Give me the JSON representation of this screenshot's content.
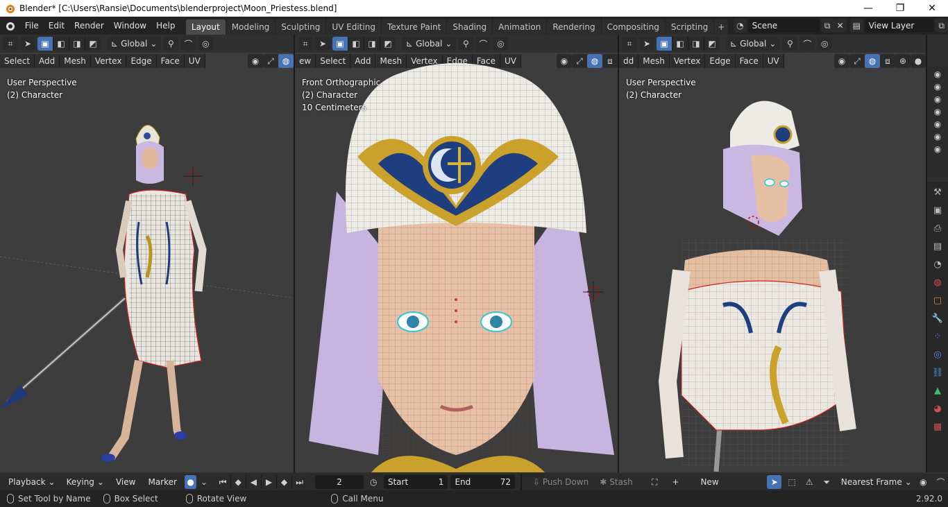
{
  "window": {
    "title": "Blender* [C:\\Users\\Ransie\\Documents\\blenderproject\\Moon_Priestess.blend]",
    "minimize": "—",
    "maximize": "❐",
    "close": "✕"
  },
  "topbar": {
    "menus": [
      "File",
      "Edit",
      "Render",
      "Window",
      "Help"
    ],
    "workspaces": [
      "Layout",
      "Modeling",
      "Sculpting",
      "UV Editing",
      "Texture Paint",
      "Shading",
      "Animation",
      "Rendering",
      "Compositing",
      "Scripting"
    ],
    "active_workspace": "Layout",
    "add_tab": "+",
    "scene": "Scene",
    "view_layer": "View Layer"
  },
  "viewports": [
    {
      "transform_orientation": "Global",
      "menus": [
        "Select",
        "Add",
        "Mesh",
        "Vertex",
        "Edge",
        "Face",
        "UV"
      ],
      "overlay_lines": [
        "User Perspective",
        "(2) Character"
      ]
    },
    {
      "transform_orientation": "Global",
      "menus": [
        "ew",
        "Select",
        "Add",
        "Mesh",
        "Vertex",
        "Edge",
        "Face",
        "UV"
      ],
      "overlay_lines": [
        "Front Orthographic",
        "(2) Character",
        "10 Centimeters"
      ]
    },
    {
      "transform_orientation": "Global",
      "menus": [
        "dd",
        "Mesh",
        "Vertex",
        "Edge",
        "Face",
        "UV"
      ],
      "overlay_lines": [
        "User Perspective",
        "(2) Character"
      ]
    }
  ],
  "timeline": {
    "playback": "Playback",
    "keying": "Keying",
    "view": "View",
    "marker": "Marker",
    "current_frame": "2",
    "start_label": "Start",
    "start": "1",
    "end_label": "End",
    "end": "72",
    "push_down": "Push Down",
    "stash": "Stash",
    "new_label": "New",
    "snap_mode": "Nearest Frame"
  },
  "statusbar": {
    "set_tool": "Set Tool by Name",
    "box_select": "Box Select",
    "rotate_view": "Rotate View",
    "call_menu": "Call Menu",
    "version": "2.92.0"
  },
  "colors": {
    "accent": "#4772b3",
    "active_tab": "#4b4b4b",
    "viewport_bg": "#3d3d3d",
    "header_bg": "#303030"
  }
}
